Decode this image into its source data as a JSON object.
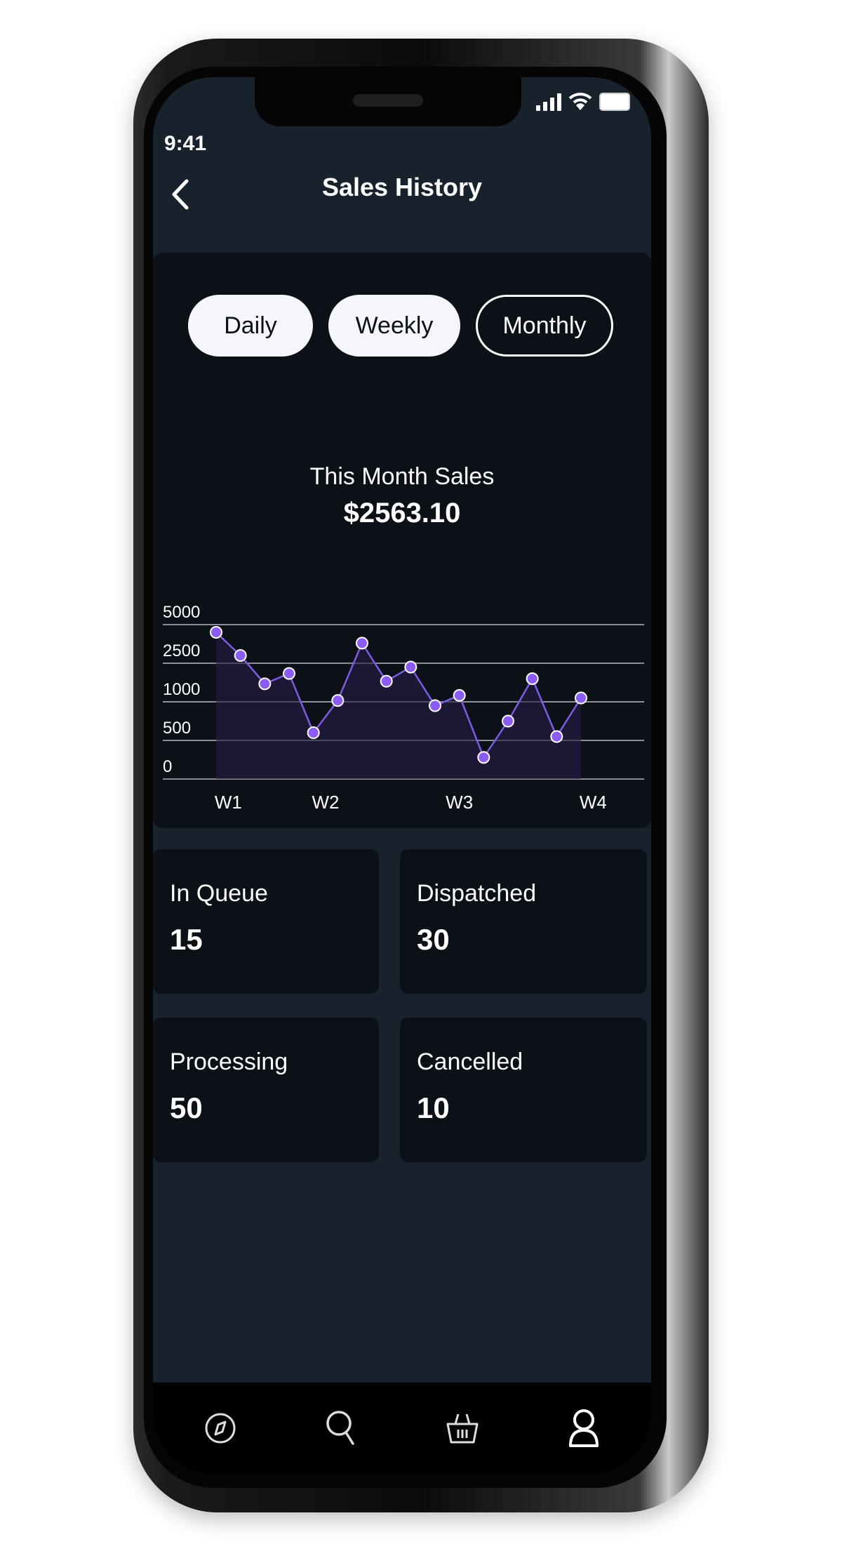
{
  "status_bar": {
    "time": "9:41"
  },
  "header": {
    "title": "Sales History",
    "back_icon": "chevron-left-icon"
  },
  "period_tabs": [
    {
      "label": "Daily",
      "style": "filled"
    },
    {
      "label": "Weekly",
      "style": "filled"
    },
    {
      "label": "Monthly",
      "style": "outline",
      "selected": true
    }
  ],
  "summary": {
    "label": "This Month Sales",
    "value": "$2563.10"
  },
  "colors": {
    "accent": "#8b5cf6",
    "line": "#7c5ce0",
    "area_fill": "#1c1836",
    "card_bg": "#0c1117",
    "screen_bg": "#18222d",
    "gridline": "#8a8f96"
  },
  "chart_data": {
    "type": "area",
    "title": "",
    "xlabel": "",
    "ylabel": "",
    "y_ticks": [
      "5000",
      "2500",
      "1000",
      "500",
      "0"
    ],
    "y_tick_values": [
      5000,
      2500,
      1000,
      500,
      0
    ],
    "y_scale": "piecewise-even (ticks evenly spaced)",
    "x_tick_labels": [
      "W1",
      "W2",
      "W3",
      "W4"
    ],
    "x_tick_positions": [
      0.5,
      4.5,
      10,
      15.5
    ],
    "grid": true,
    "legend": "none",
    "series": [
      {
        "name": "Sales",
        "x": [
          0,
          1,
          2,
          3,
          4,
          5,
          6,
          7,
          8,
          9,
          10,
          11,
          12,
          13,
          14,
          15
        ],
        "values": [
          4500,
          3000,
          1700,
          2100,
          600,
          1050,
          3800,
          1800,
          2350,
          950,
          1250,
          280,
          750,
          1900,
          550,
          1150
        ]
      }
    ]
  },
  "stats": [
    {
      "label": "In Queue",
      "value": "15"
    },
    {
      "label": "Dispatched",
      "value": "30"
    },
    {
      "label": "Processing",
      "value": "50"
    },
    {
      "label": "Cancelled",
      "value": "10"
    }
  ],
  "tab_bar": [
    {
      "name": "explore",
      "icon": "compass-icon"
    },
    {
      "name": "search",
      "icon": "search-icon"
    },
    {
      "name": "basket",
      "icon": "basket-icon"
    },
    {
      "name": "profile",
      "icon": "user-icon"
    }
  ]
}
